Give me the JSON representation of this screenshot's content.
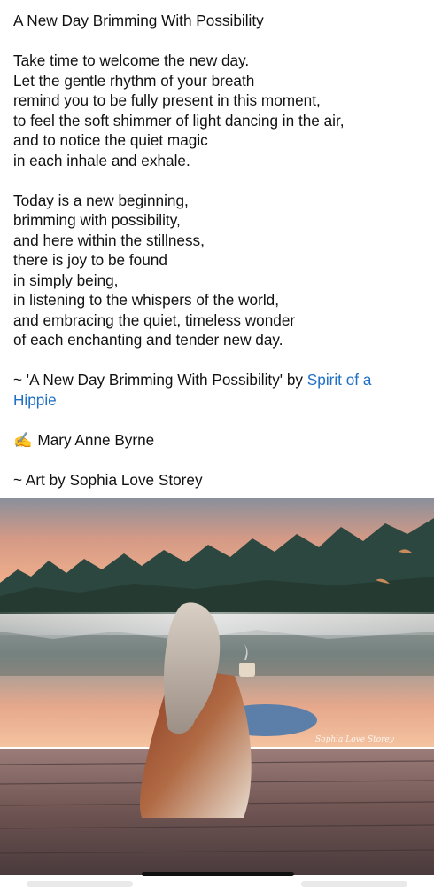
{
  "post": {
    "title": "A New Day Brimming With Possibility",
    "stanza1": [
      "Take time to welcome the new day.",
      "Let the gentle rhythm of your breath",
      "remind you to be fully present in this moment,",
      "to feel the soft shimmer of light dancing in the air,",
      "and to notice the quiet magic",
      "in each inhale and exhale."
    ],
    "stanza2": [
      "Today is a new beginning,",
      "brimming with possibility,",
      "and here within the stillness,",
      "there is joy to be found",
      "in simply being,",
      "in listening to the whispers of the world,",
      "and embracing the quiet, timeless wonder",
      "of each enchanting and tender new day."
    ],
    "attribution_prefix": "~ 'A New Day Brimming With Possibility' by ",
    "attribution_link_part1": "Spirit of a",
    "attribution_link_part2": "Hippie",
    "author_emoji": "✍️",
    "author_name": "Mary Anne Byrne",
    "art_credit": "~ Art by Sophia Love Storey"
  },
  "artwork": {
    "signature": "Sophia Love Storey",
    "colors": {
      "sky_top": "#7f8c98",
      "sky_glow": "#f0a27e",
      "forest": "#2f4a43",
      "water": "#9aa3a8",
      "dock": "#6b5350"
    }
  }
}
